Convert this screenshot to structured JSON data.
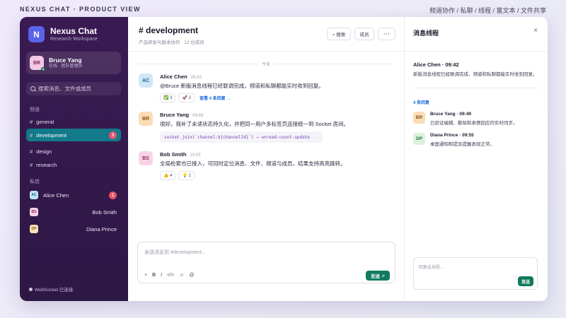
{
  "page": {
    "left_caption": "NEXUS CHAT · PRODUCT VIEW",
    "right_caption": "频道协作 / 私聊 / 线程 / 富文本 / 文件共享"
  },
  "sidebar": {
    "brand_initial": "N",
    "brand_name": "Nexus Chat",
    "brand_sub": "Research Workspace",
    "user": {
      "initials": "BR",
      "name": "Bruce Yang",
      "status": "在线 · 团队管理员"
    },
    "search_placeholder": "搜索消息、文件或成员",
    "channels_label": "频道",
    "channels": [
      {
        "name": "general",
        "badge": ""
      },
      {
        "name": "development",
        "badge": "3"
      },
      {
        "name": "design",
        "badge": ""
      },
      {
        "name": "research",
        "badge": ""
      }
    ],
    "dm_label": "私信",
    "dms": [
      {
        "initials": "AC",
        "name": "Alice Chen",
        "badge": "1"
      },
      {
        "initials": "BS",
        "name": "Bob Smith",
        "badge": ""
      },
      {
        "initials": "DP",
        "name": "Diana Prince",
        "badge": ""
      }
    ],
    "ws_status": "WebSocket 已连接"
  },
  "main": {
    "channel_title": "# development",
    "channel_desc": "产品研发与版本协作 · 12 位成员",
    "search_btn": "⌕ 搜索",
    "members_btn": "成员",
    "more_btn": "⋯",
    "date_divider": "今天",
    "messages": [
      {
        "initials": "AC",
        "author": "Alice Chen",
        "time": "09:42",
        "body": "@Bruce 新版消息线程已经联调完成，频道和私聊都能实时收到回复。",
        "reactions": [
          "✅ 3",
          "🚀 2"
        ],
        "reply_link": "查看 4 条回复 →"
      },
      {
        "initials": "BR",
        "author": "Bruce Yang",
        "time": "09:48",
        "body": "很好。我补了未读状态持久化，并把同一用户多标签页连接统一到 Socket 房间。",
        "code": "socket.join(`channel:${channelId}`)  →  unread-count-update"
      },
      {
        "initials": "BS",
        "author": "Bob Smith",
        "time": "10:03",
        "body": "全局检索也已接入，可同时定位消息、文件、频道与成员，结果支持高亮跳转。",
        "reactions": [
          "👍 4",
          "💡 1"
        ]
      }
    ],
    "composer_placeholder": "发送消息到 #development...",
    "tools": [
      "+",
      "B",
      "I",
      "</>",
      "☺",
      "@"
    ],
    "send_label": "发送 ↗"
  },
  "thread": {
    "title": "消息线程",
    "close": "×",
    "orig_head": "Alice Chen · 09:42",
    "orig_body": "新版消息线程已经联调完成，频道和私聊都能实时收到回复。",
    "count": "4 条回复",
    "replies": [
      {
        "initials": "BR",
        "head": "Bruce Yang · 09:49",
        "body": "已验证编辑、删除和表情回应的实时同步。"
      },
      {
        "initials": "DP",
        "head": "Diana Prince · 09:55",
        "body": "桌面通知和提及提醒表现正常。"
      }
    ],
    "reply_placeholder": "回复此线程...",
    "send_label": "发送"
  },
  "colors": {
    "sidebar_bg": "#3a1a52",
    "active_channel": "#127a8a",
    "send_button": "#127a5e",
    "badge": "#e8546c",
    "link": "#1b6ad8"
  }
}
